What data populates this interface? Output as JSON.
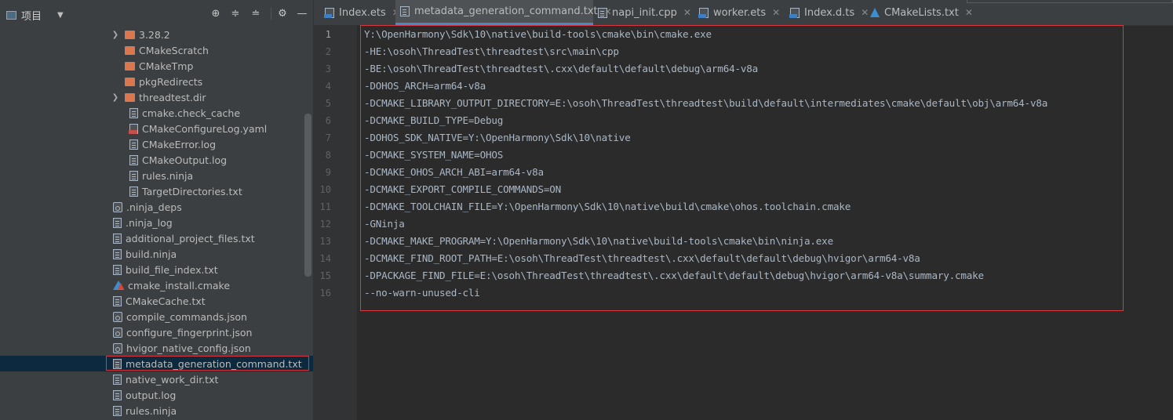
{
  "panel": {
    "title": "项目",
    "icons": [
      "crosshair-icon",
      "expand-all-icon",
      "collapse-all-icon",
      "gear-icon",
      "minimize-icon"
    ]
  },
  "tree": [
    {
      "label": "3.28.2",
      "type": "folder",
      "expandable": true,
      "indent": 145
    },
    {
      "label": "CMakeScratch",
      "type": "folder",
      "expandable": false,
      "indent": 145
    },
    {
      "label": "CMakeTmp",
      "type": "folder",
      "expandable": false,
      "indent": 145
    },
    {
      "label": "pkgRedirects",
      "type": "folder",
      "expandable": false,
      "indent": 145
    },
    {
      "label": "threadtest.dir",
      "type": "folder",
      "expandable": true,
      "indent": 145
    },
    {
      "label": "cmake.check_cache",
      "type": "file",
      "expandable": false,
      "indent": 145
    },
    {
      "label": "CMakeConfigureLog.yaml",
      "type": "yaml",
      "expandable": false,
      "indent": 145
    },
    {
      "label": "CMakeError.log",
      "type": "file",
      "expandable": false,
      "indent": 145
    },
    {
      "label": "CMakeOutput.log",
      "type": "file",
      "expandable": false,
      "indent": 145
    },
    {
      "label": "rules.ninja",
      "type": "file",
      "expandable": false,
      "indent": 145
    },
    {
      "label": "TargetDirectories.txt",
      "type": "file",
      "expandable": false,
      "indent": 145
    },
    {
      "label": ".ninja_deps",
      "type": "gear",
      "expandable": false,
      "indent": 128
    },
    {
      "label": ".ninja_log",
      "type": "file",
      "expandable": false,
      "indent": 128
    },
    {
      "label": "additional_project_files.txt",
      "type": "file",
      "expandable": false,
      "indent": 128
    },
    {
      "label": "build.ninja",
      "type": "file",
      "expandable": false,
      "indent": 128
    },
    {
      "label": "build_file_index.txt",
      "type": "file",
      "expandable": false,
      "indent": 128
    },
    {
      "label": "cmake_install.cmake",
      "type": "cmake",
      "expandable": false,
      "indent": 128
    },
    {
      "label": "CMakeCache.txt",
      "type": "file",
      "expandable": false,
      "indent": 128
    },
    {
      "label": "compile_commands.json",
      "type": "gear",
      "expandable": false,
      "indent": 128
    },
    {
      "label": "configure_fingerprint.json",
      "type": "gear",
      "expandable": false,
      "indent": 128
    },
    {
      "label": "hvigor_native_config.json",
      "type": "gear",
      "expandable": false,
      "indent": 128
    },
    {
      "label": "metadata_generation_command.txt",
      "type": "file",
      "expandable": false,
      "indent": 128,
      "selected": true
    },
    {
      "label": "native_work_dir.txt",
      "type": "file",
      "expandable": false,
      "indent": 128
    },
    {
      "label": "output.log",
      "type": "file",
      "expandable": false,
      "indent": 128
    },
    {
      "label": "rules.ninja",
      "type": "file",
      "expandable": false,
      "indent": 128
    }
  ],
  "tabs": [
    {
      "label": "Index.ets",
      "icon": "ets",
      "active": false
    },
    {
      "label": "metadata_generation_command.txt",
      "icon": "txt",
      "active": true
    },
    {
      "label": "napi_init.cpp",
      "icon": "txt",
      "active": false
    },
    {
      "label": "worker.ets",
      "icon": "ets",
      "active": false
    },
    {
      "label": "Index.d.ts",
      "icon": "ets",
      "active": false
    },
    {
      "label": "CMakeLists.txt",
      "icon": "cmake",
      "active": false
    }
  ],
  "editor": {
    "lines": [
      "Y:\\OpenHarmony\\Sdk\\10\\native\\build-tools\\cmake\\bin\\cmake.exe",
      "-HE:\\osoh\\ThreadTest\\threadtest\\src\\main\\cpp",
      "-BE:\\osoh\\ThreadTest\\threadtest\\.cxx\\default\\default\\debug\\arm64-v8a",
      "-DOHOS_ARCH=arm64-v8a",
      "-DCMAKE_LIBRARY_OUTPUT_DIRECTORY=E:\\osoh\\ThreadTest\\threadtest\\build\\default\\intermediates\\cmake\\default\\obj\\arm64-v8a",
      "-DCMAKE_BUILD_TYPE=Debug",
      "-DOHOS_SDK_NATIVE=Y:\\OpenHarmony\\Sdk\\10\\native",
      "-DCMAKE_SYSTEM_NAME=OHOS",
      "-DCMAKE_OHOS_ARCH_ABI=arm64-v8a",
      "-DCMAKE_EXPORT_COMPILE_COMMANDS=ON",
      "-DCMAKE_TOOLCHAIN_FILE=Y:\\OpenHarmony\\Sdk\\10\\native\\build\\cmake\\ohos.toolchain.cmake",
      "-GNinja",
      "-DCMAKE_MAKE_PROGRAM=Y:\\OpenHarmony\\Sdk\\10\\native\\build-tools\\cmake\\bin\\ninja.exe",
      "-DCMAKE_FIND_ROOT_PATH=E:\\osoh\\ThreadTest\\threadtest\\.cxx\\default\\default\\debug\\hvigor\\arm64-v8a",
      "-DPACKAGE_FIND_FILE=E:\\osoh\\ThreadTest\\threadtest\\.cxx\\default\\default\\debug\\hvigor\\arm64-v8a\\summary.cmake",
      "--no-warn-unused-cli"
    ]
  }
}
